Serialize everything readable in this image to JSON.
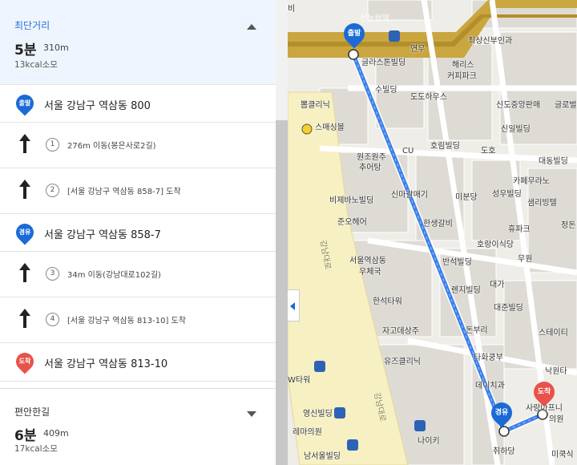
{
  "routes": [
    {
      "name": "최단거리",
      "time": "5분",
      "distance": "310m",
      "kcal": "13kcal소모",
      "expanded": true
    },
    {
      "name": "편안한길",
      "time": "6분",
      "distance": "409m",
      "kcal": "17kcal소모",
      "expanded": false
    }
  ],
  "steps": {
    "start": {
      "badge": "출발",
      "address": "서울 강남구 역삼동 800"
    },
    "s1": {
      "num": "1",
      "text": "276m 이동(봉은사로2길)"
    },
    "s2": {
      "num": "2",
      "text": "[서울 강남구 역삼동 858-7] 도착"
    },
    "via": {
      "badge": "경유",
      "address": "서울 강남구 역삼동 858-7"
    },
    "s3": {
      "num": "3",
      "text": "34m 이동(강남대로102길)"
    },
    "s4": {
      "num": "4",
      "text": "[서울 강남구 역삼동 813-10] 도착"
    },
    "end": {
      "badge": "도착",
      "address": "서울 강남구 역삼동 813-10"
    }
  },
  "map": {
    "labels": {
      "station": "신논현역",
      "l1": "연우",
      "l2": "최상신부인과",
      "l3": "글라스톤빌딩",
      "l4": "해리스",
      "l5": "커피파크",
      "l6": "수빌딩",
      "l7": "뽐클리닉",
      "l8": "도도하우스",
      "l9": "신도중앙판매",
      "l10": "글로벌",
      "l11": "스매싱볼",
      "l12": "신일빌딩",
      "l13": "원조원주",
      "l14": "추어탕",
      "l15": "CU",
      "l16": "호림빌딩",
      "l17": "도호",
      "l18": "대동빌딩",
      "l19": "카페무라노",
      "l20": "비제바노빌딩",
      "l21": "신마갈매기",
      "l22": "미분당",
      "l23": "성우빌딩",
      "l24": "샘리빙텔",
      "l25": "준오헤어",
      "l26": "한생갈비",
      "l27": "휴파크",
      "l28": "정돈",
      "l29": "서울역삼동",
      "l30": "우체국",
      "l31": "호랑이식당",
      "l32": "무원",
      "l33": "반석빌딩",
      "l34": "대가",
      "l35": "렌지빌딩",
      "l36": "한석타워",
      "l37": "대준빌딩",
      "l38": "자고데상주",
      "l39": "돈부리",
      "l40": "스테이티",
      "l41": "유즈클리닉",
      "l42": "타화쿵부",
      "l43": "낙원타",
      "l44": "W타워",
      "l45": "데이치과",
      "l46": "영신빌딩",
      "l47": "사랑아프니",
      "l48": "의원",
      "l49": "레마의원",
      "l50": "나이키",
      "l51": "취하당",
      "l52": "미쿡식",
      "l53": "남서울빌딩",
      "l54": "강남대로",
      "l55": "강남대로",
      "l56": "비"
    },
    "pins": {
      "start": "출발",
      "via": "경유",
      "end": "도착"
    },
    "route_color": "#3d7fe8",
    "accent_blue": "#1b6ad6",
    "accent_red": "#e8524a"
  }
}
